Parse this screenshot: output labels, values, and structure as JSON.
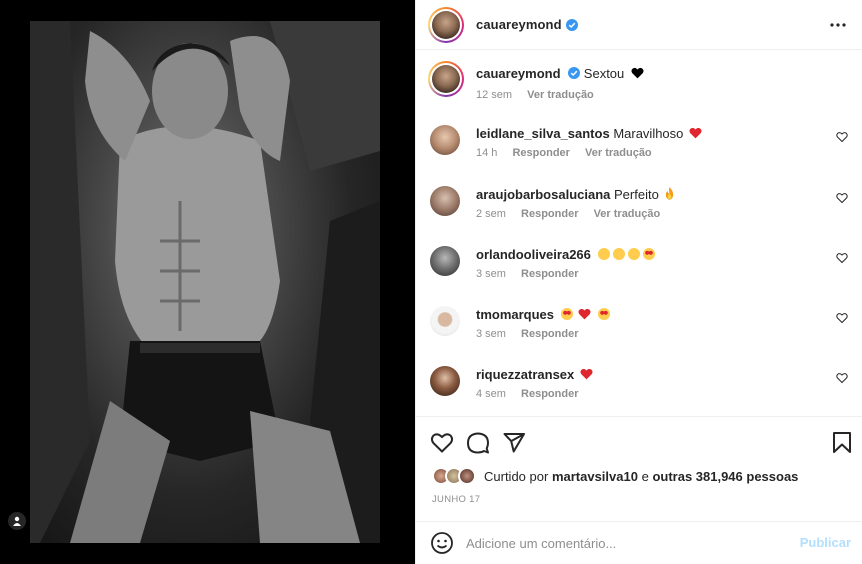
{
  "post": {
    "username": "cauareymond",
    "caption_user": "cauareymond",
    "caption_text": "Sextou",
    "caption_age": "12 sem",
    "caption_translate": "Ver tradução"
  },
  "comments": [
    {
      "user": "leidlane_silva_santos",
      "text": "Maravilhoso",
      "age": "14 h",
      "reply": "Responder",
      "translate": "Ver tradução",
      "emoji": "red-heart"
    },
    {
      "user": "araujobarbosaluciana",
      "text": "Perfeito",
      "age": "2 sem",
      "reply": "Responder",
      "translate": "Ver tradução",
      "emoji": "fire"
    },
    {
      "user": "orlandooliveira266",
      "text": "",
      "age": "3 sem",
      "reply": "Responder",
      "emoji": "face-blowing-kiss x3, smiling-face-with-heart-eyes"
    },
    {
      "user": "tmomarques",
      "text": "",
      "age": "3 sem",
      "reply": "Responder",
      "emoji": "smiling-face-with-heart-eyes, red-heart, smiling-face-with-heart-eyes"
    },
    {
      "user": "riquezzatransex",
      "text": "",
      "age": "4 sem",
      "reply": "Responder",
      "emoji": "red-heart"
    }
  ],
  "likes": {
    "prefix": "Curtido por",
    "first_user": "martavsilva10",
    "connector": "e",
    "others": "outras 381,946 pessoas"
  },
  "date": "JUNHO 17",
  "add_comment": {
    "placeholder": "Adicione um comentário...",
    "publish_label": "Publicar"
  },
  "colors": {
    "verified": "#3897f0",
    "heart_red": "#ed4956",
    "muted_text": "#8e8e8e",
    "publish_disabled": "#b2dffc"
  }
}
